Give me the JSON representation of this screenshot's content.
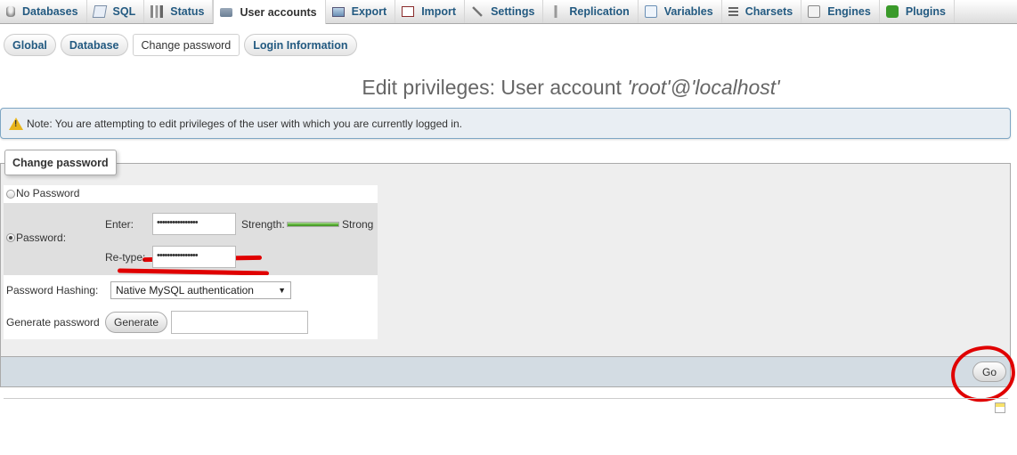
{
  "topnav": {
    "tabs": [
      {
        "label": "Databases",
        "icon": "database-icon"
      },
      {
        "label": "SQL",
        "icon": "sql-icon"
      },
      {
        "label": "Status",
        "icon": "status-icon"
      },
      {
        "label": "User accounts",
        "icon": "users-icon",
        "active": true
      },
      {
        "label": "Export",
        "icon": "export-icon"
      },
      {
        "label": "Import",
        "icon": "import-icon"
      },
      {
        "label": "Settings",
        "icon": "wrench-icon"
      },
      {
        "label": "Replication",
        "icon": "replication-icon"
      },
      {
        "label": "Variables",
        "icon": "variables-icon"
      },
      {
        "label": "Charsets",
        "icon": "charsets-icon"
      },
      {
        "label": "Engines",
        "icon": "engines-icon"
      },
      {
        "label": "Plugins",
        "icon": "plugins-icon"
      }
    ]
  },
  "subtabs": [
    {
      "label": "Global"
    },
    {
      "label": "Database"
    },
    {
      "label": "Change password",
      "active": true
    },
    {
      "label": "Login Information"
    }
  ],
  "title": {
    "prefix": "Edit privileges: User account ",
    "account": "'root'@'localhost'"
  },
  "notice": {
    "text": "Note: You are attempting to edit privileges of the user with which you are currently logged in."
  },
  "change_password": {
    "legend": "Change password",
    "no_password_label": "No Password",
    "password_label": "Password:",
    "enter_label": "Enter:",
    "enter_value": "••••••••••••••••",
    "strength_label": "Strength:",
    "strength_value": "Strong",
    "strength_level": 1.0,
    "retype_label": "Re-type:",
    "retype_value": "••••••••••••••••",
    "selected_option": "password",
    "hashing_label": "Password Hashing:",
    "hashing_selected": "Native MySQL authentication",
    "generate_label": "Generate password",
    "generate_button": "Generate",
    "generated_value": ""
  },
  "footer": {
    "go_button": "Go"
  },
  "colors": {
    "link": "#235a81",
    "annotation": "#e00000",
    "strength": "#5fb33b"
  }
}
